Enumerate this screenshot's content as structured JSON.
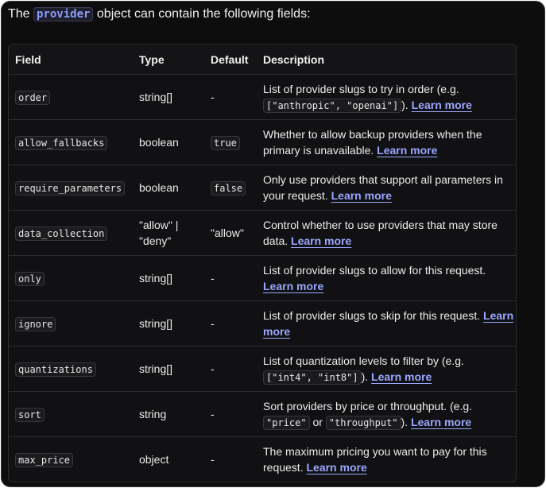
{
  "intro": {
    "prefix": "The ",
    "code": "provider",
    "suffix": " object can contain the following fields:"
  },
  "headers": {
    "field": "Field",
    "type": "Type",
    "default": "Default",
    "description": "Description"
  },
  "link_label": "Learn more",
  "rows": [
    {
      "field": "order",
      "type": "string[]",
      "default": "-",
      "default_code": false,
      "desc": "List of provider slugs to try in order (e.g. ",
      "desc_codes": [
        "[\"anthropic\", \"openai\"]"
      ],
      "desc_sep": "",
      "desc_tail": "). "
    },
    {
      "field": "allow_fallbacks",
      "type": "boolean",
      "default": "true",
      "default_code": true,
      "desc": "Whether to allow backup providers when the primary is unavailable. ",
      "desc_codes": [],
      "desc_sep": "",
      "desc_tail": ""
    },
    {
      "field": "require_parameters",
      "type": "boolean",
      "default": "false",
      "default_code": true,
      "desc": "Only use providers that support all parameters in your request. ",
      "desc_codes": [],
      "desc_sep": "",
      "desc_tail": ""
    },
    {
      "field": "data_collection",
      "type": "\"allow\" | \"deny\"",
      "default": "\"allow\"",
      "default_code": false,
      "desc": "Control whether to use providers that may store data. ",
      "desc_codes": [],
      "desc_sep": "",
      "desc_tail": ""
    },
    {
      "field": "only",
      "type": "string[]",
      "default": "-",
      "default_code": false,
      "desc": "List of provider slugs to allow for this request. ",
      "desc_codes": [],
      "desc_sep": "",
      "desc_tail": ""
    },
    {
      "field": "ignore",
      "type": "string[]",
      "default": "-",
      "default_code": false,
      "desc": "List of provider slugs to skip for this request. ",
      "desc_codes": [],
      "desc_sep": "",
      "desc_tail": ""
    },
    {
      "field": "quantizations",
      "type": "string[]",
      "default": "-",
      "default_code": false,
      "desc": "List of quantization levels to filter by (e.g. ",
      "desc_codes": [
        "[\"int4\", \"int8\"]"
      ],
      "desc_sep": "",
      "desc_tail": "). "
    },
    {
      "field": "sort",
      "type": "string",
      "default": "-",
      "default_code": false,
      "desc": "Sort providers by price or throughput. (e.g. ",
      "desc_codes": [
        "\"price\"",
        "\"throughput\""
      ],
      "desc_sep": " or ",
      "desc_tail": "). "
    },
    {
      "field": "max_price",
      "type": "object",
      "default": "-",
      "default_code": false,
      "desc": "The maximum pricing you want to pay for this request. ",
      "desc_codes": [],
      "desc_sep": "",
      "desc_tail": ""
    }
  ]
}
